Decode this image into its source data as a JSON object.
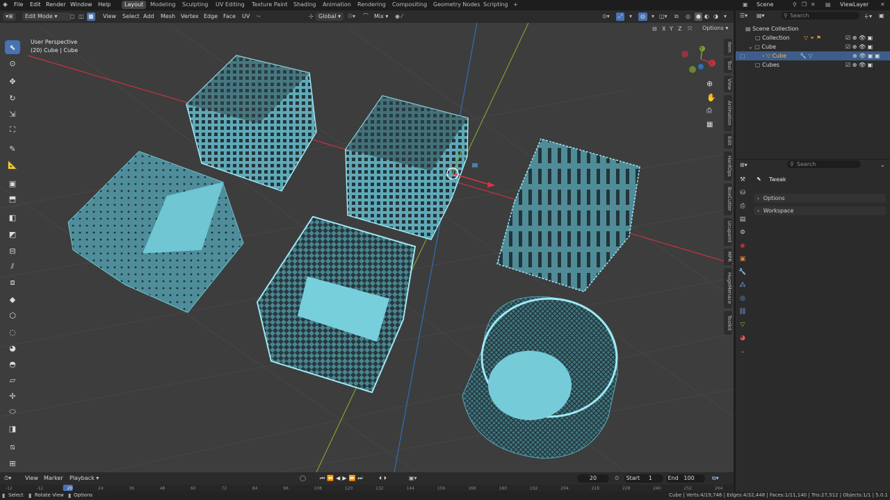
{
  "topbar": {
    "menus": [
      "File",
      "Edit",
      "Render",
      "Window",
      "Help"
    ],
    "workspaces": [
      "Layout",
      "Modeling",
      "Sculpting",
      "UV Editing",
      "Texture Paint",
      "Shading",
      "Animation",
      "Rendering",
      "Compositing",
      "Geometry Nodes",
      "Scripting"
    ],
    "active_workspace": "Layout",
    "add_tab": "+",
    "scene_label": "Scene",
    "viewlayer_label": "ViewLayer"
  },
  "viewport_header": {
    "mode": "Edit Mode",
    "menus": [
      "View",
      "Select",
      "Add",
      "Mesh",
      "Vertex",
      "Edge",
      "Face",
      "UV"
    ],
    "orientation": "Global",
    "snap_mode": "Mix",
    "options": "Options",
    "axes": [
      "X",
      "Y",
      "Z"
    ]
  },
  "overlay_text": {
    "perspective": "User Perspective",
    "object_info": "(20) Cube | Cube"
  },
  "side_tabs": [
    "Item",
    "Tool",
    "View",
    "Animation",
    "Edit",
    "HardOps",
    "BoxCutter",
    "Ucupaint",
    "MPR",
    "HugeMenace",
    "Toolkit"
  ],
  "outliner": {
    "search_placeholder": "Search",
    "items": [
      {
        "label": "Scene Collection",
        "indent": 0
      },
      {
        "label": "Collection",
        "indent": 1
      },
      {
        "label": "Cube",
        "indent": 1
      },
      {
        "label": "Cube",
        "indent": 2,
        "selected": true
      },
      {
        "label": "Cubes",
        "indent": 1
      }
    ]
  },
  "properties": {
    "search_placeholder": "Search",
    "tool_name": "Tweak",
    "panels": [
      "Options",
      "Workspace"
    ]
  },
  "timeline": {
    "menus": [
      "View",
      "Marker",
      "Playback"
    ],
    "current_frame": "20",
    "start_label": "Start",
    "start_value": "1",
    "end_label": "End",
    "end_value": "100",
    "ruler_ticks": [
      "-12",
      "-12",
      "20",
      "24",
      "36",
      "48",
      "60",
      "72",
      "84",
      "96",
      "108",
      "120",
      "132",
      "144",
      "156",
      "168",
      "180",
      "192",
      "204",
      "216",
      "228",
      "240",
      "252",
      "264"
    ]
  },
  "statusbar": {
    "left": [
      "Select",
      "Rotate View",
      "Options"
    ],
    "stats": "Cube | Verts:4/19,746 | Edges:4/32,448 | Faces:1/11,140 | Tris:27,512 | Objects:1/1 | 5.0.1"
  },
  "colors": {
    "accent": "#4772b3",
    "mesh": "#5fa9b8",
    "mesh_edge": "#9fe8f4",
    "viewport": "#3d3d3d",
    "x_axis": "#c9323f",
    "y_axis": "#7ea22a",
    "z_axis": "#2f6fb5"
  }
}
